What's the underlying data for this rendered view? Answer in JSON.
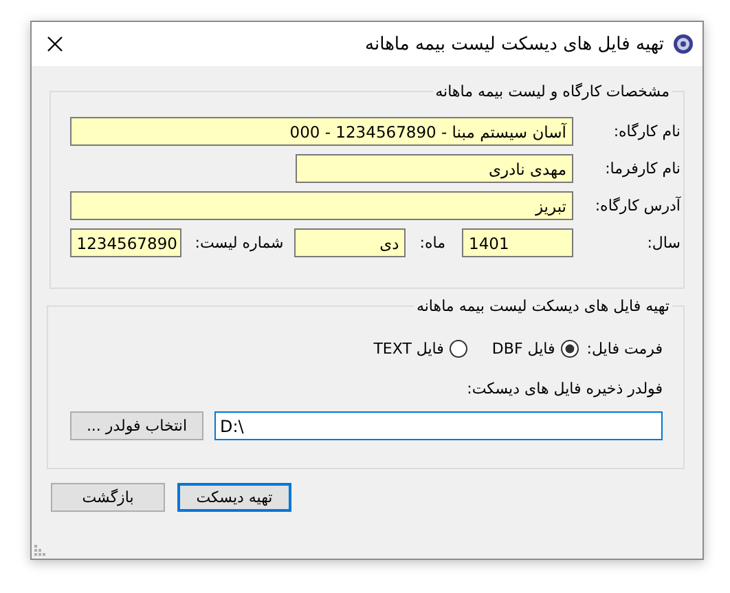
{
  "window": {
    "title": "تهیه فایل های دیسکت لیست بیمه ماهانه"
  },
  "workshop": {
    "title": "مشخصات کارگاه و لیست بیمه ماهانه",
    "name": {
      "label": "نام کارگاه:",
      "value": "آسان سیستم مبنا - 1234567890 - 000"
    },
    "employer": {
      "label": "نام کارفرما:",
      "value": "مهدی نادری"
    },
    "address": {
      "label": "آدرس کارگاه:",
      "value": "تبریز"
    },
    "year": {
      "label": "سال:",
      "value": "1401"
    },
    "month": {
      "label": "ماه:",
      "value": "دی"
    },
    "list_number": {
      "label": "شماره لیست:",
      "value": "1234567890"
    }
  },
  "disk": {
    "title": "تهیه فایل های دیسکت لیست بیمه ماهانه",
    "format_label": "فرمت فایل:",
    "formats": [
      {
        "label": "فایل DBF",
        "selected": true
      },
      {
        "label": "فایل TEXT",
        "selected": false
      }
    ],
    "folder_label": "فولدر ذخیره فایل های دیسکت:",
    "folder_path": "D:\\",
    "browse_button": "انتخاب فولدر ..."
  },
  "buttons": [
    {
      "label": "تهیه دیسکت",
      "focused": true
    },
    {
      "label": "بازگشت",
      "focused": false
    }
  ]
}
